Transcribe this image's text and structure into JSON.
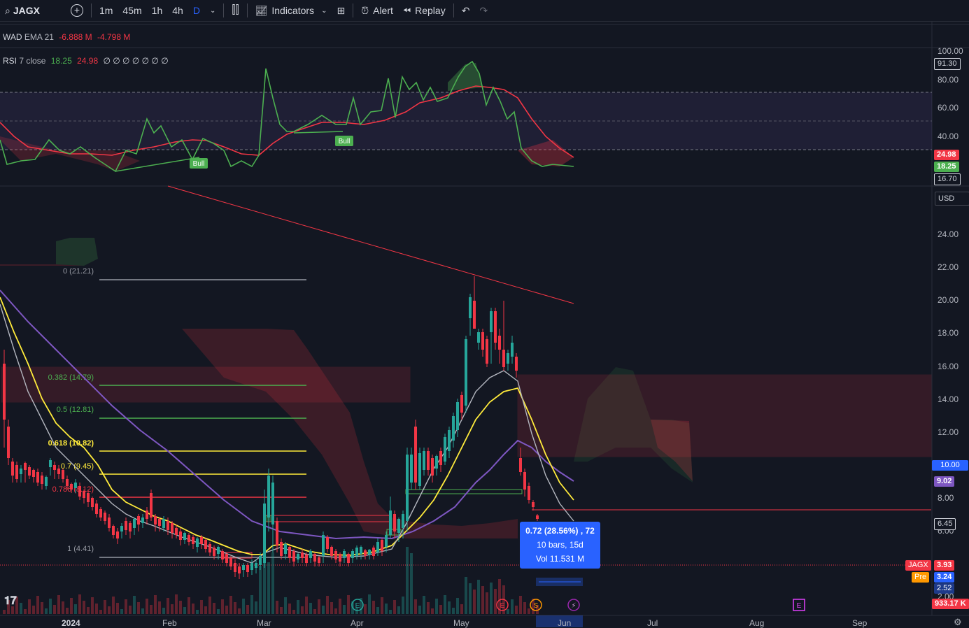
{
  "toolbar": {
    "symbol": "JAGX",
    "intervals": [
      "1m",
      "45m",
      "1h",
      "4h",
      "D"
    ],
    "indicators_label": "Indicators",
    "alert_label": "Alert",
    "replay_label": "Replay"
  },
  "wad": {
    "name": "WAD",
    "ema": "EMA 21",
    "v1": "-6.888 M",
    "v2": "-4.798 M"
  },
  "rsi": {
    "name": "RSI",
    "params": "7 close",
    "v1": "18.25",
    "v2": "24.98",
    "dots": "∅ ∅ ∅ ∅ ∅ ∅ ∅",
    "scale": [
      "100.00",
      "80.00",
      "60.00",
      "40.00"
    ],
    "tags": {
      "top": "91.30",
      "ma": "24.98",
      "rsi": "18.25",
      "low": "16.70"
    },
    "bull_labels": [
      "Bull",
      "Bull"
    ]
  },
  "currency": "USD",
  "price_scale": [
    "24.00",
    "22.00",
    "20.00",
    "18.00",
    "16.00",
    "14.00",
    "12.00",
    "10.00",
    "8.00",
    "6.00",
    "2.00"
  ],
  "price_tags": {
    "cross": "10.00",
    "ma": "9.02",
    "level": "6.45",
    "symbol": "JAGX",
    "last": "3.93",
    "pre_label": "Pre",
    "pre": "3.24",
    "low": "2.52",
    "volume": "933.17 K"
  },
  "fib": [
    {
      "label": "0 (21.21)",
      "color": "#9598a1"
    },
    {
      "label": "0.382 (14.79)",
      "color": "#4caf50"
    },
    {
      "label": "0.5 (12.81)",
      "color": "#4caf50"
    },
    {
      "label": "0.618 (10.82)",
      "color": "#ffeb3b"
    },
    {
      "label": "0.7 (9.45)",
      "color": "#ffeb3b"
    },
    {
      "label": "0.786 (8.12)",
      "color": "#f23645"
    },
    {
      "label": "1 (4.41)",
      "color": "#9598a1"
    }
  ],
  "measure": {
    "line1": "0.72 (28.56%) , 72",
    "line2": "10 bars, 15d",
    "line3": "Vol 11.531 M"
  },
  "x_axis": [
    "2024",
    "Feb",
    "Mar",
    "Apr",
    "May",
    "Jun",
    "Jul",
    "Aug",
    "Sep"
  ],
  "event_markers": [
    "E",
    "E",
    "S",
    "⚡",
    "E"
  ],
  "colors": {
    "up": "#26a69a",
    "down": "#f23645",
    "rsi": "#4caf50",
    "rsi_ma": "#f23645",
    "ema_fast": "#b2b5be",
    "ema_mid": "#ffeb3b",
    "ema_slow": "#7e57c2",
    "accent": "#2962ff"
  }
}
